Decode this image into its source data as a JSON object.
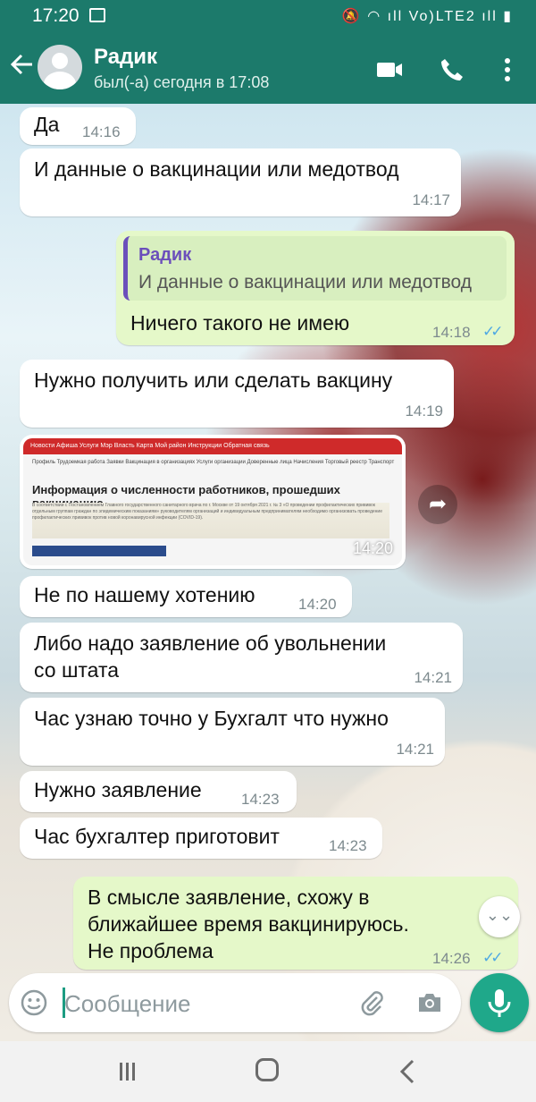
{
  "status_bar": {
    "time": "17:20",
    "icons_text": "🔕 ◠ ıll Vo)LTE2 ıll ▮"
  },
  "header": {
    "contact_name": "Радик",
    "contact_status": "был(-а) сегодня в 17:08"
  },
  "messages": [
    {
      "type": "in",
      "text": "Да",
      "time": "14:16"
    },
    {
      "type": "in",
      "text": "И данные о вакцинации или медотвод",
      "time": "14:17"
    },
    {
      "type": "out",
      "quote_name": "Радик",
      "quote_text": "И данные о вакцинации или медотвод",
      "text": "Ничего такого не имею",
      "time": "14:18",
      "ticks": "✓✓"
    },
    {
      "type": "in",
      "text": "Нужно получить или сделать вакцину",
      "time": "14:19"
    },
    {
      "type": "image",
      "time": "14:20",
      "image_nav": "Новости   Афиша   Услуги   Мэр   Власть   Карта   Мой район   Инструкции   Обратная связь",
      "image_nav2": "Профиль   Трудоемкая работа   Заявки   Вакцинация в организациях   Услуги организации   Доверенные лица   Начисления   Торговый реестр   Транспорт",
      "image_title": "Информация о численности работников, прошедших вакцинацию",
      "image_text": "В соответствии с Постановлением Главного государственного санитарного врача по г. Москве от 19 октября 2021 г. № 3 «О проведении профилактических прививок отдельным группам граждан по эпидемическим показаниям» руководителям организаций и индивидуальным предпринимателям необходимо организовать проведение профилактических прививок против новой коронавирусной инфекции (COVID-19)."
    },
    {
      "type": "in",
      "text": "Не по нашему хотению",
      "time": "14:20"
    },
    {
      "type": "in",
      "text_line1": "Либо надо заявление об увольнении",
      "text_line2": "со штата",
      "time": "14:21"
    },
    {
      "type": "in",
      "text": "Час узнаю точно у Бухгалт что нужно",
      "time": "14:21"
    },
    {
      "type": "in",
      "text": "Нужно заявление",
      "time": "14:23"
    },
    {
      "type": "in",
      "text": "Час бухгалтер приготовит",
      "time": "14:23"
    },
    {
      "type": "out",
      "text_line1": "В смысле заявление, схожу в",
      "text_line2": "ближайшее время вакцинируюсь.",
      "text_line3": "Не проблема",
      "time": "14:26",
      "ticks": "✓✓"
    }
  ],
  "composer": {
    "placeholder": "Сообщение"
  },
  "colors": {
    "header": "#1c7a6b",
    "incoming": "#ffffff",
    "outgoing": "#e5f8c9",
    "accent": "#1fa88a",
    "ticks": "#4fa9e3"
  },
  "icons": [
    "back-arrow-icon",
    "avatar-icon",
    "video-call-icon",
    "phone-icon",
    "more-icon",
    "forward-icon",
    "scroll-down-icon",
    "emoji-icon",
    "attach-icon",
    "camera-icon",
    "mic-icon"
  ]
}
